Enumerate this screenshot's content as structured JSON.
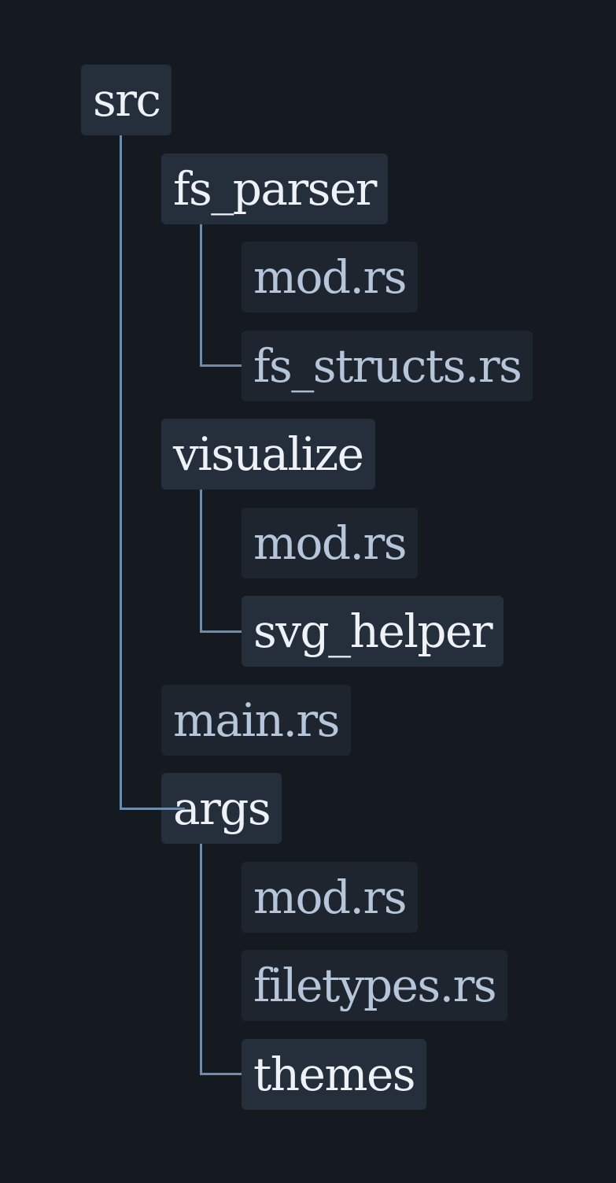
{
  "tree": {
    "name": "src",
    "type": "dir",
    "children": [
      {
        "name": "fs_parser",
        "type": "dir",
        "children": [
          {
            "name": "mod.rs",
            "type": "file"
          },
          {
            "name": "fs_structs.rs",
            "type": "file"
          }
        ]
      },
      {
        "name": "visualize",
        "type": "dir",
        "children": [
          {
            "name": "mod.rs",
            "type": "file"
          },
          {
            "name": "svg_helper",
            "type": "dir"
          }
        ]
      },
      {
        "name": "main.rs",
        "type": "file"
      },
      {
        "name": "args",
        "type": "dir",
        "children": [
          {
            "name": "mod.rs",
            "type": "file"
          },
          {
            "name": "filetypes.rs",
            "type": "file"
          },
          {
            "name": "themes",
            "type": "dir"
          }
        ]
      }
    ]
  },
  "colors": {
    "background": "#151a21",
    "connector": "#6d8bab",
    "dir_box": "#242f3b",
    "dir_text": "#eef2f6",
    "file_box": "#1f252e",
    "file_text": "#b6c6da"
  }
}
